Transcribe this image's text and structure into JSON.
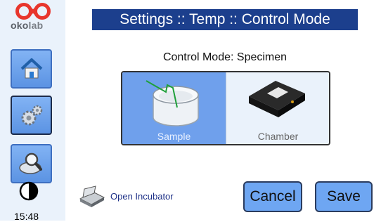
{
  "brand": {
    "logo_text_a": "oko",
    "logo_text_b": "lab"
  },
  "sidebar": {
    "items": [
      {
        "icon": "home-icon"
      },
      {
        "icon": "gears-icon",
        "active": true
      },
      {
        "icon": "magnifier-icon"
      }
    ],
    "contrast_icon": "contrast-icon",
    "clock": "15:48"
  },
  "header": {
    "title": "Settings :: Temp :: Control Mode"
  },
  "control_mode": {
    "label": "Control Mode: Specimen",
    "options": [
      {
        "label": "Sample",
        "selected": true,
        "icon": "sample-dish-icon"
      },
      {
        "label": "Chamber",
        "selected": false,
        "icon": "chamber-icon"
      }
    ]
  },
  "footer": {
    "open_incubator_label": "Open Incubator",
    "open_incubator_icon": "incubator-icon",
    "cancel_label": "Cancel",
    "save_label": "Save"
  },
  "colors": {
    "title_bg": "#1c3f8d",
    "selected_option": "#6fa0ec",
    "button_bg": "#6ea6f2",
    "logo_red": "#e8362d"
  }
}
